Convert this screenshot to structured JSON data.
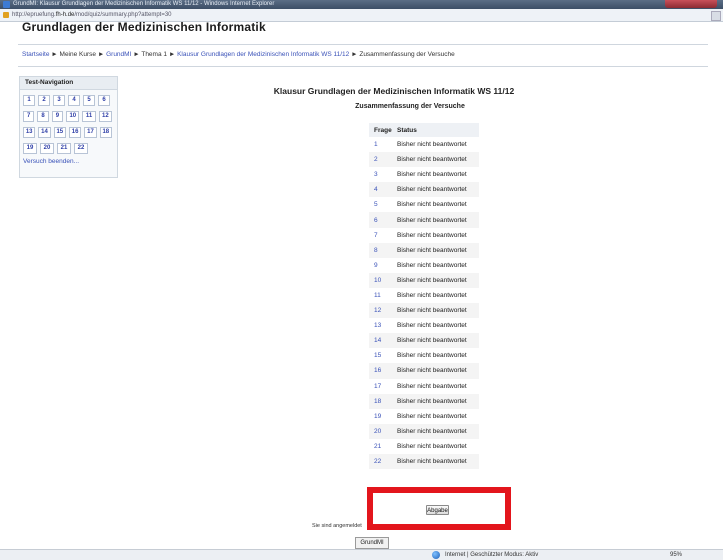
{
  "window": {
    "title": "GrundMI: Klausur Grundlagen der Medizinischen Informatik WS 11/12 - Windows Internet Explorer",
    "url_prefix": "http://epruefung.",
    "url_domain": "fh-h.de",
    "url_path": "/mod/quiz/summary.php?attempt=30"
  },
  "site_title": "Grundlagen der Medizinischen Informatik",
  "breadcrumb": {
    "home": "Startseite",
    "sep": "►",
    "my_courses": "Meine Kurse",
    "course": "GrundMI",
    "topic": "Thema 1",
    "quiz": "Klausur Grundlagen der Medizinischen Informatik WS 11/12",
    "current": "Zusammenfassung der Versuche"
  },
  "nav": {
    "heading": "Test-Navigation",
    "rows": [
      [
        "1",
        "2",
        "3",
        "4",
        "5",
        "6"
      ],
      [
        "7",
        "8",
        "9",
        "10",
        "11",
        "12"
      ],
      [
        "13",
        "14",
        "15",
        "16",
        "17",
        "18"
      ],
      [
        "19",
        "20",
        "21",
        "22"
      ]
    ],
    "finish_label": "Versuch beenden..."
  },
  "main": {
    "quiz_title": "Klausur Grundlagen der Medizinischen Informatik WS 11/12",
    "summary_heading": "Zusammenfassung der Versuche",
    "table": {
      "headers": [
        "Frage",
        "Status"
      ],
      "status_text": "Bisher nicht beantwortet",
      "rows": [
        "1",
        "2",
        "3",
        "4",
        "5",
        "6",
        "7",
        "8",
        "9",
        "10",
        "11",
        "12",
        "13",
        "14",
        "15",
        "16",
        "17",
        "18",
        "19",
        "20",
        "21",
        "22"
      ]
    },
    "submit_label": "Abgabe",
    "highlight_color": "#e3151c"
  },
  "footer": {
    "login_text": "Sie sind angemeldet",
    "course_button": "GrundMI"
  },
  "statusbar": {
    "zone_text": "Internet | Geschützter Modus: Aktiv",
    "security_label": "",
    "zoom": "95%"
  }
}
